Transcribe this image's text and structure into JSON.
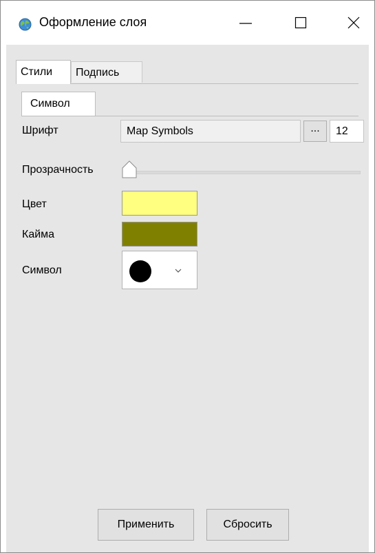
{
  "window": {
    "title": "Оформление слоя",
    "icon": "globe-icon",
    "controls": [
      "minimize-icon",
      "maximize-icon",
      "close-icon"
    ]
  },
  "tabs": [
    {
      "label": "Стили",
      "active": true
    },
    {
      "label": "Подпись",
      "active": false
    }
  ],
  "subtabs": [
    {
      "label": "Символ",
      "active": true
    }
  ],
  "form": {
    "font_label": "Шрифт",
    "font_value": "Map Symbols",
    "font_browse_label": "...",
    "font_size_value": "12",
    "transparency_label": "Прозрачность",
    "transparency_value": 0,
    "color_label": "Цвет",
    "color_value": "#ffff80",
    "border_label": "Кайма",
    "border_value": "#808000",
    "symbol_label": "Символ",
    "symbol_icon": "filled-circle-icon"
  },
  "buttons": {
    "apply_label": "Применить",
    "reset_label": "Сбросить"
  }
}
